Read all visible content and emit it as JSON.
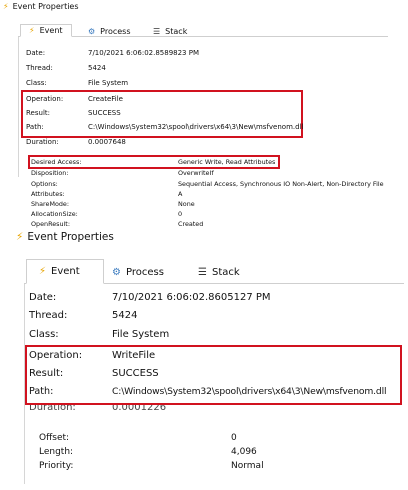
{
  "panel1": {
    "window_title": "Event Properties",
    "tabs": [
      {
        "label": "Event",
        "icon": "lightning-icon"
      },
      {
        "label": "Process",
        "icon": "gear-icon"
      },
      {
        "label": "Stack",
        "icon": "stack-icon"
      }
    ],
    "rows": [
      {
        "label": "Date:",
        "value": "7/10/2021 6:06:02.8589823 PM"
      },
      {
        "label": "Thread:",
        "value": "5424"
      },
      {
        "label": "Class:",
        "value": "File System"
      },
      {
        "label": "Operation:",
        "value": "CreateFile"
      },
      {
        "label": "Result:",
        "value": "SUCCESS"
      },
      {
        "label": "Path:",
        "value": "C:\\Windows\\System32\\spool\\drivers\\x64\\3\\New\\msfvenom.dll"
      },
      {
        "label": "Duration:",
        "value": "0.0007648"
      }
    ],
    "details": [
      {
        "label": "Desired Access:",
        "value": "Generic Write, Read Attributes"
      },
      {
        "label": "Disposition:",
        "value": "OverwriteIf"
      },
      {
        "label": "Options:",
        "value": "Sequential Access, Synchronous IO Non-Alert, Non-Directory File"
      },
      {
        "label": "Attributes:",
        "value": "A"
      },
      {
        "label": "ShareMode:",
        "value": "None"
      },
      {
        "label": "AllocationSize:",
        "value": "0"
      },
      {
        "label": "OpenResult:",
        "value": "Created"
      }
    ]
  },
  "panel2": {
    "window_title": "Event Properties",
    "tabs": [
      {
        "label": "Event",
        "icon": "lightning-icon"
      },
      {
        "label": "Process",
        "icon": "gear-icon"
      },
      {
        "label": "Stack",
        "icon": "stack-icon"
      }
    ],
    "rows": [
      {
        "label": "Date:",
        "value": "7/10/2021 6:06:02.8605127 PM"
      },
      {
        "label": "Thread:",
        "value": "5424"
      },
      {
        "label": "Class:",
        "value": "File System"
      },
      {
        "label": "Operation:",
        "value": "WriteFile"
      },
      {
        "label": "Result:",
        "value": "SUCCESS"
      },
      {
        "label": "Path:",
        "value": "C:\\Windows\\System32\\spool\\drivers\\x64\\3\\New\\msfvenom.dll"
      },
      {
        "label": "Duration:",
        "value": "0.0001226"
      }
    ],
    "details": [
      {
        "label": "Offset:",
        "value": "0"
      },
      {
        "label": "Length:",
        "value": "4,096"
      },
      {
        "label": "Priority:",
        "value": "Normal"
      }
    ]
  },
  "colors": {
    "highlight_box": "#d1121f",
    "event_icon": "#e7a400",
    "process_icon": "#3b7bbf"
  }
}
